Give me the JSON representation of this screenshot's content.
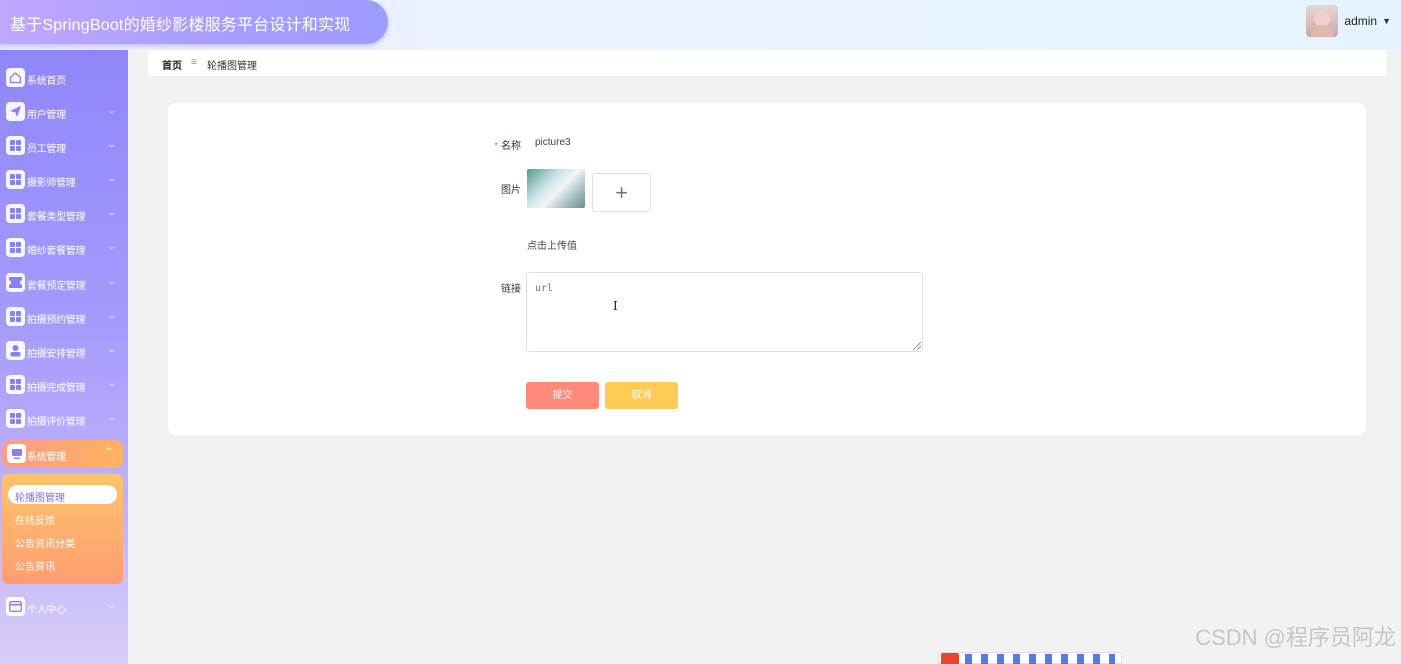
{
  "app": {
    "title": "基于SpringBoot的婚纱影楼服务平台设计和实现"
  },
  "user": {
    "name": "admin"
  },
  "sidebar": {
    "items": [
      {
        "label": "系统首页",
        "icon": "home-icon"
      },
      {
        "label": "用户管理",
        "icon": "send-icon"
      },
      {
        "label": "员工管理",
        "icon": "grid-icon"
      },
      {
        "label": "摄影师管理",
        "icon": "grid-icon"
      },
      {
        "label": "套餐类型管理",
        "icon": "grid-icon"
      },
      {
        "label": "婚纱套餐管理",
        "icon": "grid-icon"
      },
      {
        "label": "套餐预定管理",
        "icon": "ticket-icon"
      },
      {
        "label": "拍摄预约管理",
        "icon": "grid-icon"
      },
      {
        "label": "拍摄安排管理",
        "icon": "person-icon"
      },
      {
        "label": "拍摄完成管理",
        "icon": "grid-icon"
      },
      {
        "label": "拍摄评价管理",
        "icon": "grid-icon"
      },
      {
        "label": "系统管理",
        "icon": "monitor-icon"
      },
      {
        "label": "个人中心",
        "icon": "card-icon"
      }
    ],
    "submenu": [
      {
        "label": "轮播图管理",
        "active": true
      },
      {
        "label": "在线反馈",
        "active": false
      },
      {
        "label": "公告资讯分类",
        "active": false
      },
      {
        "label": "公告资讯",
        "active": false
      }
    ]
  },
  "breadcrumb": {
    "home": "首页",
    "separator": "≡",
    "current": "轮播图管理"
  },
  "form": {
    "name_label": "名称",
    "name_required_mark": "*",
    "name_value": "picture3",
    "image_label": "图片",
    "upload_plus": "+",
    "upload_hint": "点击上传值",
    "link_label": "链接",
    "link_placeholder": "url",
    "link_value": "",
    "submit_label": "提交",
    "cancel_label": "取消"
  },
  "watermark": "CSDN @程序员阿龙",
  "colors": {
    "sidebar_top": "#8f86fb",
    "active_menu": "#ff9b8a",
    "submit": "#ff8a7a",
    "cancel": "#ffcb52"
  }
}
